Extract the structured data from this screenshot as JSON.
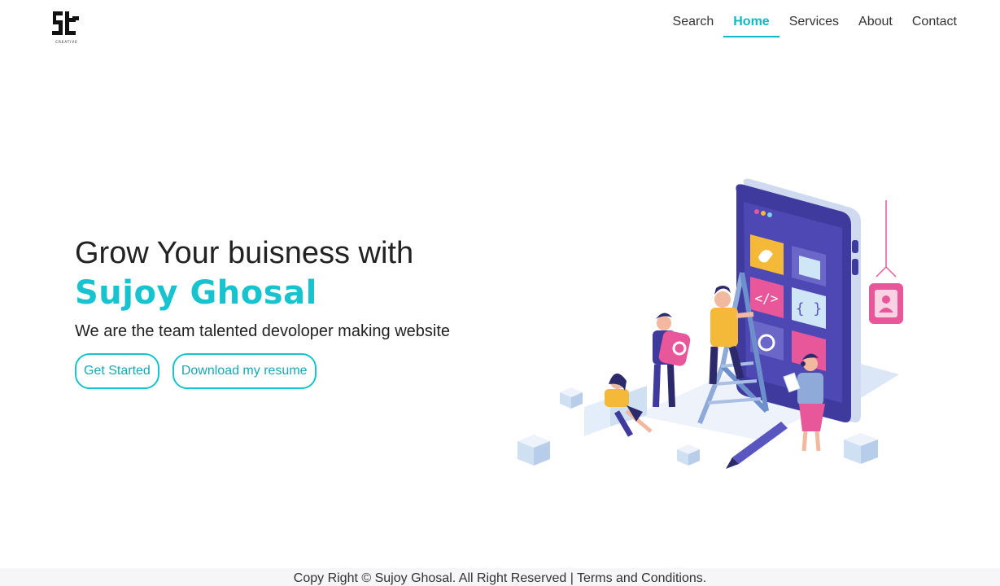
{
  "header": {
    "logo_icon": "sc-creative-logo",
    "nav": [
      {
        "label": "Search",
        "active": false
      },
      {
        "label": "Home",
        "active": true
      },
      {
        "label": "Services",
        "active": false
      },
      {
        "label": "About",
        "active": false
      },
      {
        "label": "Contact",
        "active": false
      }
    ]
  },
  "hero": {
    "title": "Grow Your buisness with",
    "name": "Sujoy Ghosal",
    "subtitle": "We are the team talented devoloper making website",
    "primary_button": "Get Started",
    "secondary_button": "Download my resume"
  },
  "footer": {
    "copyright": "Copy Right © Sujoy Ghosal. All Right Reserved | Terms and Conditions."
  },
  "colors": {
    "accent": "#17c3cf",
    "phone": "#3f3a9e",
    "pink": "#e8579a",
    "yellow": "#f5b93a"
  }
}
